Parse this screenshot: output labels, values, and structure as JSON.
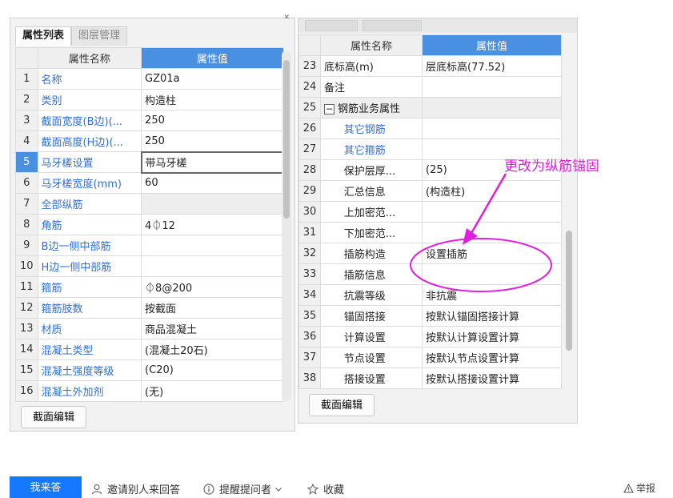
{
  "left_panel": {
    "tabs": [
      "属性列表",
      "图层管理"
    ],
    "header": {
      "name": "属性名称",
      "value": "属性值"
    },
    "rows": [
      {
        "num": "1",
        "name": "名称",
        "value": "GZ01a",
        "blue": true
      },
      {
        "num": "2",
        "name": "类别",
        "value": "构造柱",
        "blue": true
      },
      {
        "num": "3",
        "name": "截面宽度(B边)(...",
        "value": "250",
        "blue": true
      },
      {
        "num": "4",
        "name": "截面高度(H边)(...",
        "value": "250",
        "blue": true
      },
      {
        "num": "5",
        "name": "马牙槎设置",
        "value": "带马牙槎",
        "blue": true,
        "selected": true
      },
      {
        "num": "6",
        "name": "马牙槎宽度(mm)",
        "value": "60",
        "blue": true
      },
      {
        "num": "7",
        "name": "全部纵筋",
        "value": "",
        "blue": true,
        "grey": true
      },
      {
        "num": "8",
        "name": "角筋",
        "value": "4⏀12",
        "blue": true
      },
      {
        "num": "9",
        "name": "B边一侧中部筋",
        "value": "",
        "blue": true
      },
      {
        "num": "10",
        "name": "H边一侧中部筋",
        "value": "",
        "blue": true
      },
      {
        "num": "11",
        "name": "箍筋",
        "value": "⏀8@200",
        "blue": true
      },
      {
        "num": "12",
        "name": "箍筋肢数",
        "value": "按截面",
        "blue": true
      },
      {
        "num": "13",
        "name": "材质",
        "value": "商品混凝土",
        "blue": true
      },
      {
        "num": "14",
        "name": "混凝土类型",
        "value": "(混凝土20石)",
        "blue": true
      },
      {
        "num": "15",
        "name": "混凝土强度等级",
        "value": "(C20)",
        "blue": true
      },
      {
        "num": "16",
        "name": "混凝土外加剂",
        "value": "(无)",
        "blue": true
      }
    ],
    "button": "截面编辑"
  },
  "right_panel": {
    "header": {
      "name": "属性名称",
      "value": "属性值"
    },
    "rows": [
      {
        "num": "23",
        "name": "底标高(m)",
        "value": "层底标高(77.52)"
      },
      {
        "num": "24",
        "name": "备注",
        "value": ""
      },
      {
        "num": "25",
        "name": "钢筋业务属性",
        "value": "",
        "group": true
      },
      {
        "num": "26",
        "name": "其它钢筋",
        "value": "",
        "blue": true,
        "child": true
      },
      {
        "num": "27",
        "name": "其它箍筋",
        "value": "",
        "blue": true,
        "child": true
      },
      {
        "num": "28",
        "name": "保护层厚...",
        "value": "(25)",
        "child": true
      },
      {
        "num": "29",
        "name": "汇总信息",
        "value": "(构造柱)",
        "child": true
      },
      {
        "num": "30",
        "name": "上加密范...",
        "value": "",
        "child": true
      },
      {
        "num": "31",
        "name": "下加密范...",
        "value": "",
        "child": true
      },
      {
        "num": "32",
        "name": "插筋构造",
        "value": "设置插筋",
        "child": true
      },
      {
        "num": "33",
        "name": "插筋信息",
        "value": "",
        "child": true
      },
      {
        "num": "34",
        "name": "抗震等级",
        "value": "非抗震",
        "child": true
      },
      {
        "num": "35",
        "name": "锚固搭接",
        "value": "按默认锚固搭接计算",
        "child": true
      },
      {
        "num": "36",
        "name": "计算设置",
        "value": "按默认计算设置计算",
        "child": true
      },
      {
        "num": "37",
        "name": "节点设置",
        "value": "按默认节点设置计算",
        "child": true
      },
      {
        "num": "38",
        "name": "搭接设置",
        "value": "按默认搭接设置计算",
        "child": true
      }
    ],
    "button": "截面编辑"
  },
  "annotation": {
    "text": "更改为纵筋锚固",
    "color": "#e01ee0"
  },
  "footer": {
    "answer": "我来答",
    "invite": "邀请别人来回答",
    "remind": "提醒提问者",
    "favorite": "收藏",
    "report": "举报"
  },
  "colors": {
    "accent": "#4a90e2",
    "link_blue": "#2f6fd6",
    "primary_button": "#1677ff"
  }
}
